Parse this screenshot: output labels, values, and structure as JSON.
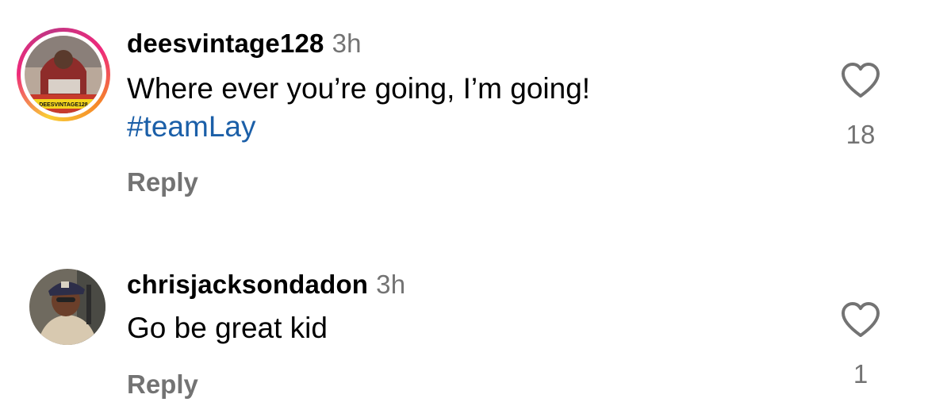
{
  "comments": [
    {
      "username": "deesvintage128",
      "time": "3h",
      "text": "Where ever you’re going, I’m going!",
      "hashtag": "#teamLay",
      "reply_label": "Reply",
      "like_count": "18",
      "avatar_caption": "DEESVINTAGE128",
      "has_story_ring": true
    },
    {
      "username": "chrisjacksondadon",
      "time": "3h",
      "text": "Go be great kid",
      "reply_label": "Reply",
      "like_count": "1",
      "has_story_ring": false
    }
  ],
  "icons": {
    "like": "heart-outline-icon"
  },
  "colors": {
    "hashtag": "#1b5fa8",
    "secondary_text": "#737373",
    "primary_text": "#000000"
  }
}
